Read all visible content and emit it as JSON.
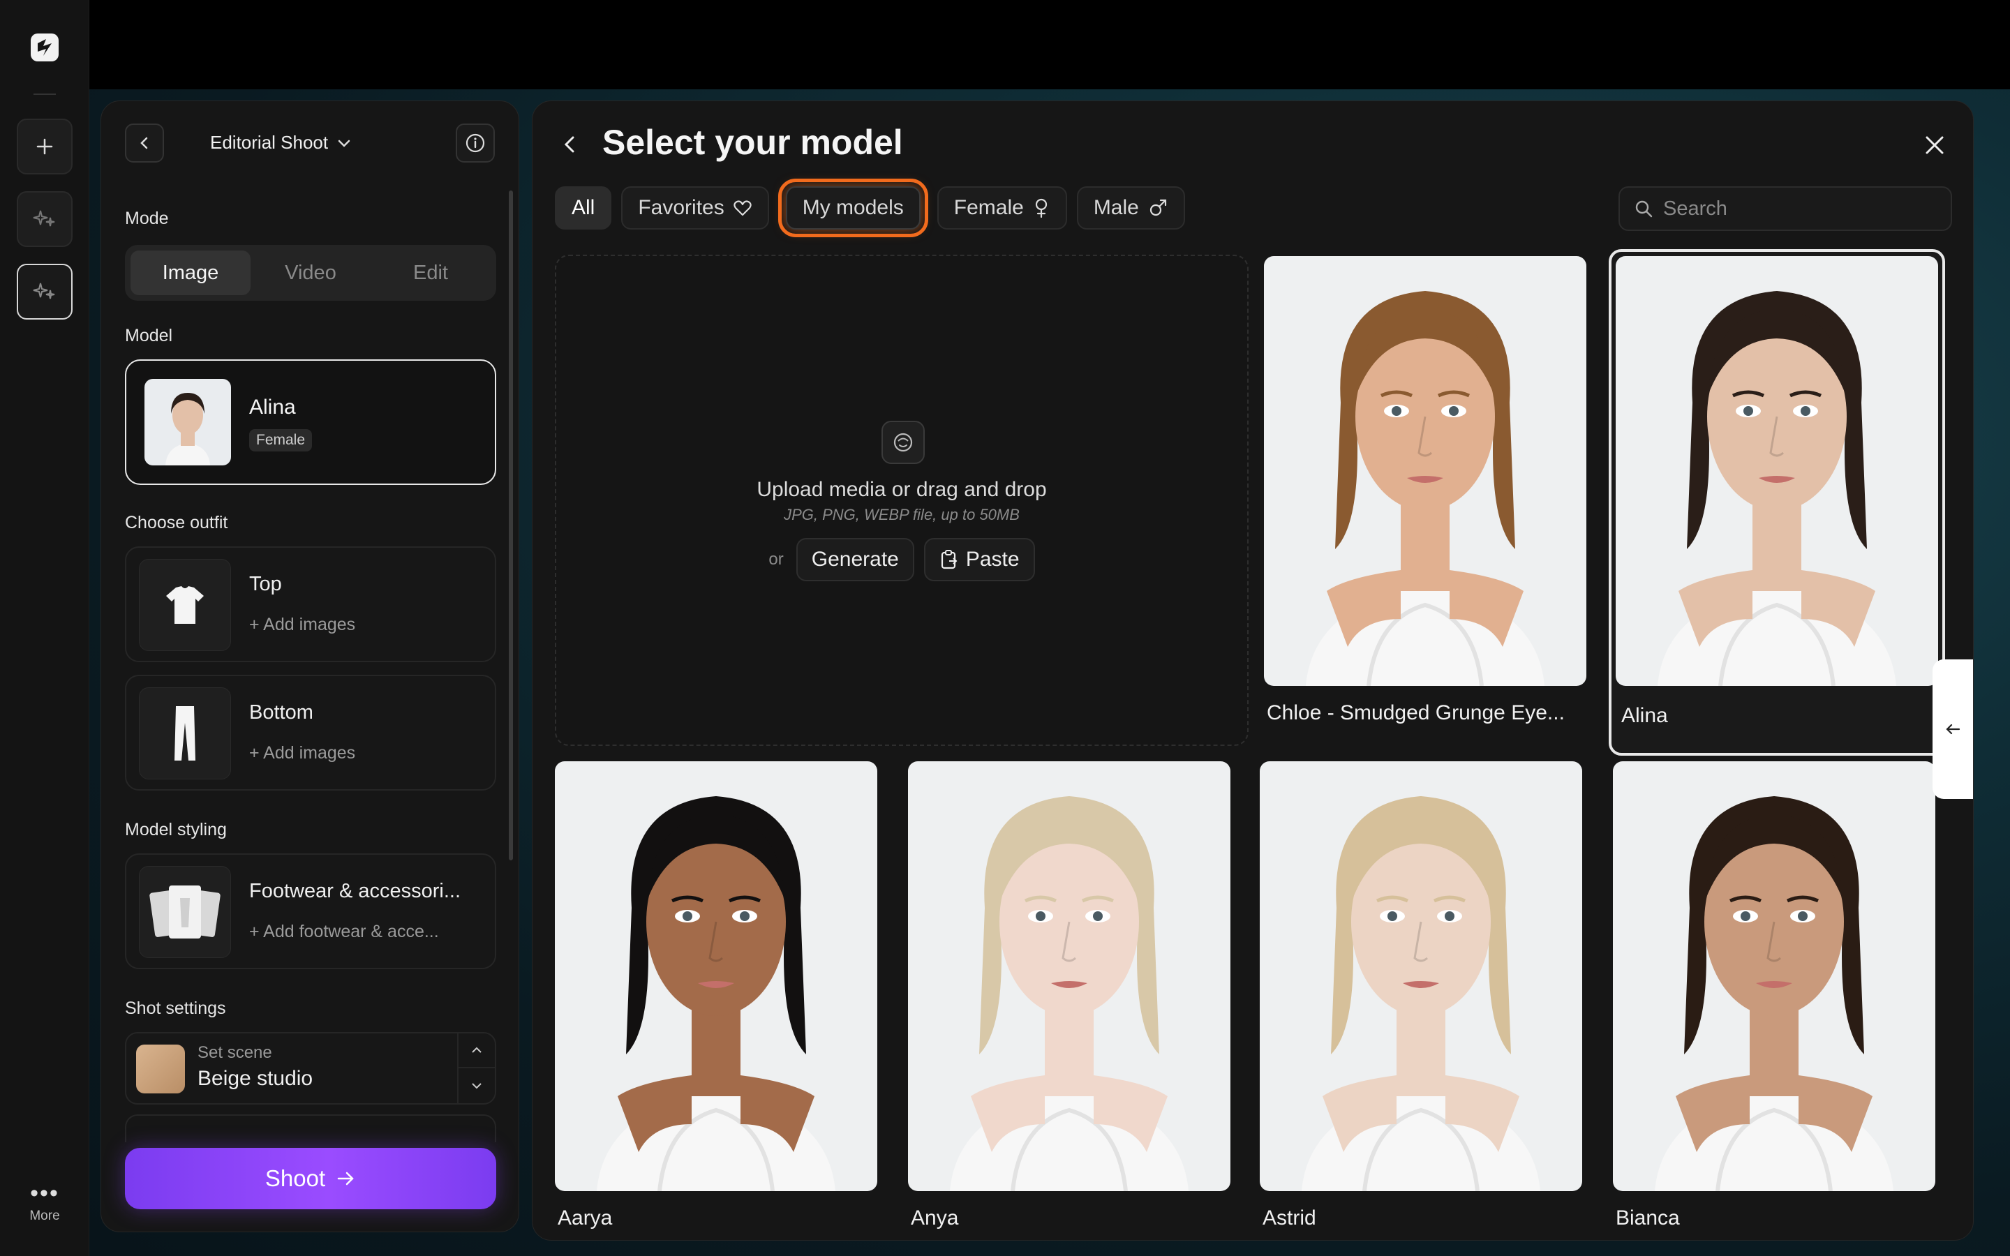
{
  "sidebar": {
    "more_label": "More",
    "icons": [
      "app-logo",
      "plus-icon",
      "sparkle-icon",
      "sparkle-icon"
    ]
  },
  "panel": {
    "shoot_name": "Editorial Shoot",
    "mode_label": "Mode",
    "modes": [
      {
        "label": "Image",
        "active": true
      },
      {
        "label": "Video",
        "active": false
      },
      {
        "label": "Edit",
        "active": false
      }
    ],
    "model_label": "Model",
    "model": {
      "name": "Alina",
      "gender": "Female"
    },
    "outfit_label": "Choose outfit",
    "outfits": [
      {
        "title": "Top",
        "action": "+ Add images"
      },
      {
        "title": "Bottom",
        "action": "+ Add images"
      }
    ],
    "styling_label": "Model styling",
    "styling": {
      "title": "Footwear & accessori...",
      "action": "+ Add footwear & acce..."
    },
    "shot_settings_label": "Shot settings",
    "scene": {
      "label": "Set scene",
      "value": "Beige studio"
    },
    "shoot_button": "Shoot"
  },
  "selector": {
    "title": "Select your model",
    "filters": [
      {
        "label": "All",
        "state": "selected"
      },
      {
        "label": "Favorites",
        "icon": "heart-icon"
      },
      {
        "label": "My models",
        "state": "highlighted"
      },
      {
        "label": "Female",
        "icon": "female-icon"
      },
      {
        "label": "Male",
        "icon": "male-icon"
      }
    ],
    "search_placeholder": "Search",
    "upload": {
      "title": "Upload media or drag and drop",
      "subtitle": "JPG, PNG, WEBP file, up to 50MB",
      "or": "or",
      "generate": "Generate",
      "paste": "Paste"
    },
    "models": [
      {
        "name": "Chloe - Smudged Grunge Eye...",
        "selected": false,
        "hair": "#8a5a30",
        "skin": "#e1b090"
      },
      {
        "name": "Alina",
        "selected": true,
        "hair": "#2a1e18",
        "skin": "#e3c0a8"
      },
      {
        "name": "Aarya",
        "selected": false,
        "hair": "#121010",
        "skin": "#a36b4a"
      },
      {
        "name": "Anya",
        "selected": false,
        "hair": "#d8c8a8",
        "skin": "#f0d8cc"
      },
      {
        "name": "Astrid",
        "selected": false,
        "hair": "#d6c09a",
        "skin": "#ecd4c4"
      },
      {
        "name": "Bianca",
        "selected": false,
        "hair": "#2a1c14",
        "skin": "#c99a7c"
      }
    ]
  }
}
